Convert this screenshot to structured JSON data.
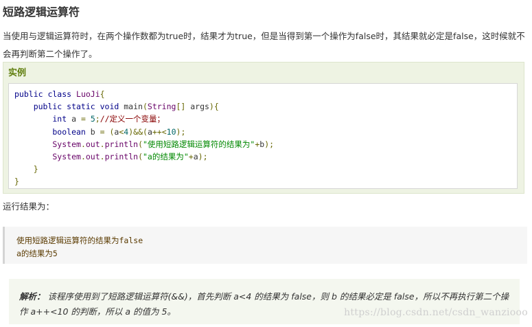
{
  "heading": "短路逻辑运算符",
  "intro": "当使用与逻辑运算符时，在两个操作数都为true时，结果才为true，但是当得到第一个操作为false时，其结果就必定是false，这时候就不会再判断第二个操作了。",
  "example": {
    "label": "实例",
    "code": {
      "l1_kw": "public class ",
      "l1_cls": "LuoJi",
      "l1_pun": "{",
      "l2_kw": "    public static void ",
      "l2_fn": "main",
      "l2_p1": "(",
      "l2_typ": "String",
      "l2_p2": "[] ",
      "l2_arg": "args",
      "l2_p3": "){",
      "l3_kw": "        int ",
      "l3_var": "a",
      "l3_p1": " = ",
      "l3_lit": "5",
      "l3_p2": ";",
      "l3_com": "//定义一个变量；",
      "l4_kw": "        boolean ",
      "l4_var": "b",
      "l4_p1": " = (",
      "l4_v2": "a",
      "l4_p2": "<",
      "l4_lit": "4",
      "l4_p3": ")&&(",
      "l4_v3": "a",
      "l4_p4": "++<",
      "l4_lit2": "10",
      "l4_p5": ");",
      "l5_typ": "        System",
      "l5_p1": ".",
      "l5_f1": "out",
      "l5_p2": ".",
      "l5_f2": "println",
      "l5_p3": "(",
      "l5_str": "\"使用短路逻辑运算符的结果为\"",
      "l5_p4": "+",
      "l5_var": "b",
      "l5_p5": ");",
      "l6_typ": "        System",
      "l6_p1": ".",
      "l6_f1": "out",
      "l6_p2": ".",
      "l6_f2": "println",
      "l6_p3": "(",
      "l6_str": "\"a的结果为\"",
      "l6_p4": "+",
      "l6_var": "a",
      "l6_p5": ");",
      "l7": "    }",
      "l8": "}"
    }
  },
  "run_label": "运行结果为：",
  "output": {
    "line1": "使用短路逻辑运算符的结果为false",
    "line2": "a的结果为5"
  },
  "analysis": {
    "lead": "解析：",
    "text": "该程序使用到了短路逻辑运算符(&&)，首先判断 a<4 的结果为 false，则 b 的结果必定是 false，所以不再执行第二个操作 a++<10 的判断，所以 a 的值为 5。"
  },
  "watermark": "https://blog.csdn.net/csdn_wanziooo"
}
